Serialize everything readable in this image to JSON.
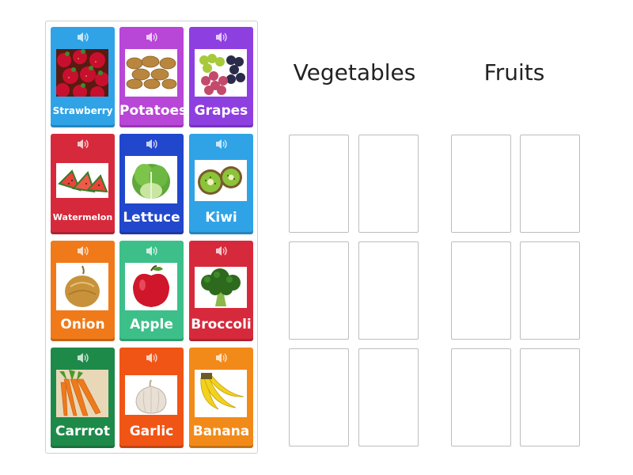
{
  "groups": {
    "vegetables": "Vegetables",
    "fruits": "Fruits"
  },
  "cards": [
    {
      "label": "Strawberry",
      "icon": "strawberry-image",
      "color": "#2fa3e6"
    },
    {
      "label": "Potatoes",
      "icon": "potatoes-image",
      "color": "#b846d6"
    },
    {
      "label": "Grapes",
      "icon": "grapes-image",
      "color": "#8e3fe0"
    },
    {
      "label": "Watermelon",
      "icon": "watermelon-image",
      "color": "#d62a3c"
    },
    {
      "label": "Lettuce",
      "icon": "lettuce-image",
      "color": "#2147cc"
    },
    {
      "label": "Kiwi",
      "icon": "kiwi-image",
      "color": "#2fa3e6"
    },
    {
      "label": "Onion",
      "icon": "onion-image",
      "color": "#f07a1a"
    },
    {
      "label": "Apple",
      "icon": "apple-image",
      "color": "#3dbf8a"
    },
    {
      "label": "Broccoli",
      "icon": "broccoli-image",
      "color": "#d62a3c"
    },
    {
      "label": "Carrrot",
      "icon": "carrot-image",
      "color": "#1e8a4a"
    },
    {
      "label": "Garlic",
      "icon": "garlic-image",
      "color": "#f05516"
    },
    {
      "label": "Banana",
      "icon": "banana-image",
      "color": "#f28a1a"
    }
  ]
}
